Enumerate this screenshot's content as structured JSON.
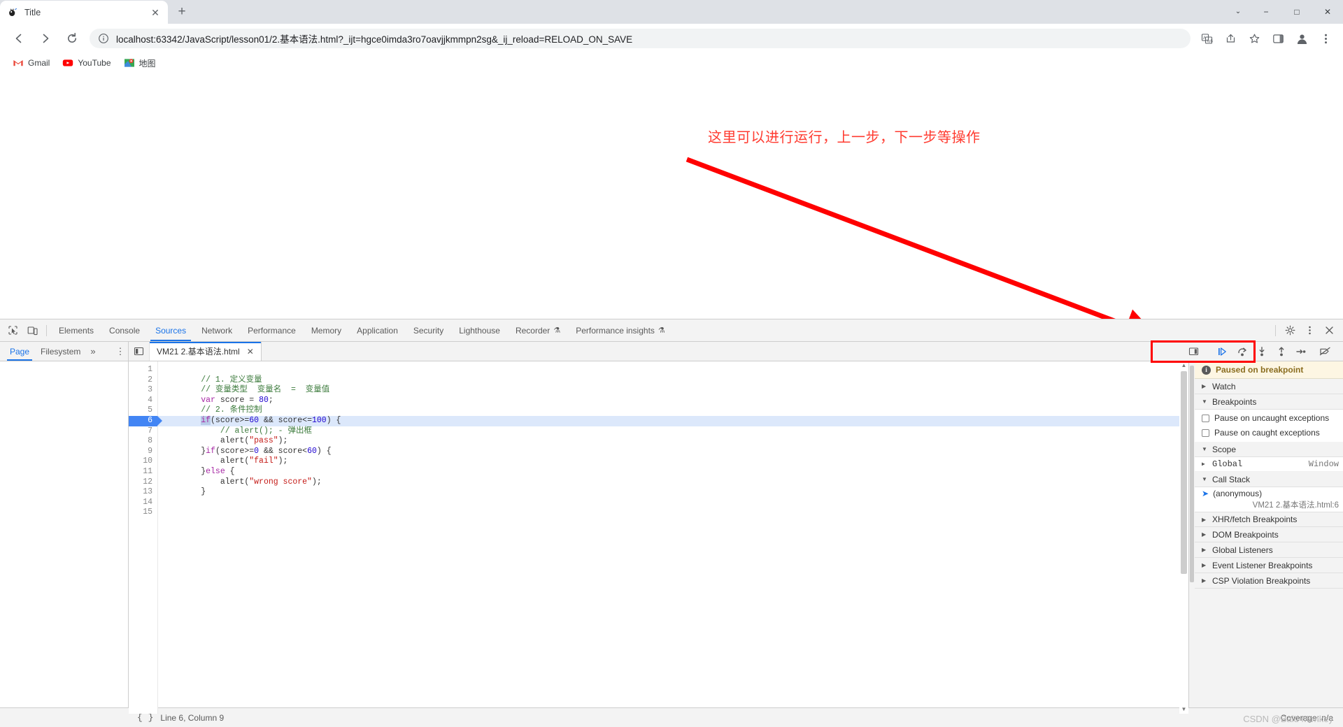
{
  "browser": {
    "tab": {
      "title": "Title",
      "favicon": "bug-favicon",
      "close_label": "✕"
    },
    "new_tab_label": "+",
    "window_controls": {
      "dropdown": "⌄",
      "minimize": "−",
      "maximize": "□",
      "close": "✕"
    },
    "nav": {
      "back": "←",
      "forward": "→",
      "reload": "↻"
    },
    "omnibox": {
      "security_icon": "info-circle-icon",
      "url": "localhost:63342/JavaScript/lesson01/2.基本语法.html?_ijt=hgce0imda3ro7oavjjkmmpn2sg&_ij_reload=RELOAD_ON_SAVE"
    },
    "toolbar_icons": [
      "translate-icon",
      "share-icon",
      "star-icon",
      "sidepanel-icon",
      "profile-icon",
      "menu-icon"
    ],
    "bookmarks": [
      {
        "label": "Gmail",
        "icon": "gmail-icon"
      },
      {
        "label": "YouTube",
        "icon": "youtube-icon"
      },
      {
        "label": "地图",
        "icon": "maps-icon"
      }
    ]
  },
  "annotation": {
    "text": "这里可以进行运行，上一步，下一步等操作",
    "color": "#ff3b30"
  },
  "devtools": {
    "left_icons": [
      "inspect-icon",
      "device-toolbar-icon"
    ],
    "tabs": [
      {
        "label": "Elements",
        "active": false,
        "flask": false
      },
      {
        "label": "Console",
        "active": false,
        "flask": false
      },
      {
        "label": "Sources",
        "active": true,
        "flask": false
      },
      {
        "label": "Network",
        "active": false,
        "flask": false
      },
      {
        "label": "Performance",
        "active": false,
        "flask": false
      },
      {
        "label": "Memory",
        "active": false,
        "flask": false
      },
      {
        "label": "Application",
        "active": false,
        "flask": false
      },
      {
        "label": "Security",
        "active": false,
        "flask": false
      },
      {
        "label": "Lighthouse",
        "active": false,
        "flask": false
      },
      {
        "label": "Recorder",
        "active": false,
        "flask": true
      },
      {
        "label": "Performance insights",
        "active": false,
        "flask": true
      }
    ],
    "right_icons": [
      "settings-gear-icon",
      "more-kebab-icon",
      "close-icon"
    ],
    "navigator": {
      "tabs": [
        {
          "label": "Page",
          "active": true
        },
        {
          "label": "Filesystem",
          "active": false
        }
      ],
      "more": "»",
      "kebab": "⋮"
    },
    "editor": {
      "panel_toggle_icon": "show-navigator-icon",
      "file_tab": {
        "label": "VM21 2.基本语法.html",
        "close": "✕"
      },
      "more_tabs_icon": "more-tabs-icon"
    },
    "debug_controls": [
      {
        "name": "resume-script-execution",
        "icon": "resume-icon",
        "active": true
      },
      {
        "name": "step-over-next-function-call",
        "icon": "step-over-icon",
        "active": false
      },
      {
        "name": "step-into-next-function-call",
        "icon": "step-into-icon",
        "active": false
      },
      {
        "name": "step-out-of-current-function",
        "icon": "step-out-icon",
        "active": false
      },
      {
        "name": "step",
        "icon": "step-icon",
        "active": false
      },
      {
        "name": "deactivate-breakpoints",
        "icon": "deactivate-breakpoints-icon",
        "active": false
      }
    ],
    "code": {
      "highlight_line": 6,
      "lines": [
        {
          "n": 1,
          "tokens": []
        },
        {
          "n": 2,
          "tokens": [
            {
              "t": "        ",
              "c": "plain"
            },
            {
              "t": "// 1. 定义变量",
              "c": "cmt"
            }
          ]
        },
        {
          "n": 3,
          "tokens": [
            {
              "t": "        ",
              "c": "plain"
            },
            {
              "t": "// 变量类型  变量名  =  变量值",
              "c": "cmt"
            }
          ]
        },
        {
          "n": 4,
          "tokens": [
            {
              "t": "        ",
              "c": "plain"
            },
            {
              "t": "var",
              "c": "kw"
            },
            {
              "t": " score = ",
              "c": "plain"
            },
            {
              "t": "80",
              "c": "num"
            },
            {
              "t": ";",
              "c": "plain"
            }
          ]
        },
        {
          "n": 5,
          "tokens": [
            {
              "t": "        ",
              "c": "plain"
            },
            {
              "t": "// 2. 条件控制",
              "c": "cmt"
            }
          ]
        },
        {
          "n": 6,
          "tokens": [
            {
              "t": "        ",
              "c": "plain"
            },
            {
              "t": "if",
              "c": "kw-hl"
            },
            {
              "t": "(score>=",
              "c": "plain"
            },
            {
              "t": "60",
              "c": "num"
            },
            {
              "t": " && score<=",
              "c": "plain"
            },
            {
              "t": "100",
              "c": "num"
            },
            {
              "t": ") {",
              "c": "plain"
            }
          ]
        },
        {
          "n": 7,
          "tokens": [
            {
              "t": "            ",
              "c": "plain"
            },
            {
              "t": "// alert(); - 弹出框",
              "c": "cmt"
            }
          ]
        },
        {
          "n": 8,
          "tokens": [
            {
              "t": "            alert(",
              "c": "plain"
            },
            {
              "t": "\"pass\"",
              "c": "str"
            },
            {
              "t": ");",
              "c": "plain"
            }
          ]
        },
        {
          "n": 9,
          "tokens": [
            {
              "t": "        }",
              "c": "plain"
            },
            {
              "t": "if",
              "c": "kw"
            },
            {
              "t": "(score>=",
              "c": "plain"
            },
            {
              "t": "0",
              "c": "num"
            },
            {
              "t": " && score<",
              "c": "plain"
            },
            {
              "t": "60",
              "c": "num"
            },
            {
              "t": ") {",
              "c": "plain"
            }
          ]
        },
        {
          "n": 10,
          "tokens": [
            {
              "t": "            alert(",
              "c": "plain"
            },
            {
              "t": "\"fail\"",
              "c": "str"
            },
            {
              "t": ");",
              "c": "plain"
            }
          ]
        },
        {
          "n": 11,
          "tokens": [
            {
              "t": "        }",
              "c": "plain"
            },
            {
              "t": "else",
              "c": "kw"
            },
            {
              "t": " {",
              "c": "plain"
            }
          ]
        },
        {
          "n": 12,
          "tokens": [
            {
              "t": "            alert(",
              "c": "plain"
            },
            {
              "t": "\"wrong score\"",
              "c": "str"
            },
            {
              "t": ");",
              "c": "plain"
            }
          ]
        },
        {
          "n": 13,
          "tokens": [
            {
              "t": "        }",
              "c": "plain"
            }
          ]
        },
        {
          "n": 14,
          "tokens": []
        },
        {
          "n": 15,
          "tokens": []
        }
      ]
    },
    "sidebar": {
      "paused_banner": "Paused on breakpoint",
      "sections": [
        {
          "id": "watch",
          "label": "Watch",
          "expanded": false
        },
        {
          "id": "breakpoints",
          "label": "Breakpoints",
          "expanded": true
        },
        {
          "id": "scope",
          "label": "Scope",
          "expanded": true
        },
        {
          "id": "callstack",
          "label": "Call Stack",
          "expanded": true
        },
        {
          "id": "xhr",
          "label": "XHR/fetch Breakpoints",
          "expanded": false
        },
        {
          "id": "dom",
          "label": "DOM Breakpoints",
          "expanded": false
        },
        {
          "id": "globallisteners",
          "label": "Global Listeners",
          "expanded": false
        },
        {
          "id": "eventlistener",
          "label": "Event Listener Breakpoints",
          "expanded": false
        },
        {
          "id": "csp",
          "label": "CSP Violation Breakpoints",
          "expanded": false
        }
      ],
      "breakpoint_options": [
        {
          "label": "Pause on uncaught exceptions",
          "checked": false
        },
        {
          "label": "Pause on caught exceptions",
          "checked": false
        }
      ],
      "scope_rows": [
        {
          "name": "Global",
          "value": "Window"
        }
      ],
      "call_stack": [
        {
          "frame": "(anonymous)",
          "location": "VM21 2.基本语法.html:6"
        }
      ]
    },
    "status": {
      "format_icon": "{ }",
      "position": "Line 6, Column 9",
      "coverage": "Coverage: n/a"
    }
  },
  "watermark": "CSDN @Bald Monkey"
}
